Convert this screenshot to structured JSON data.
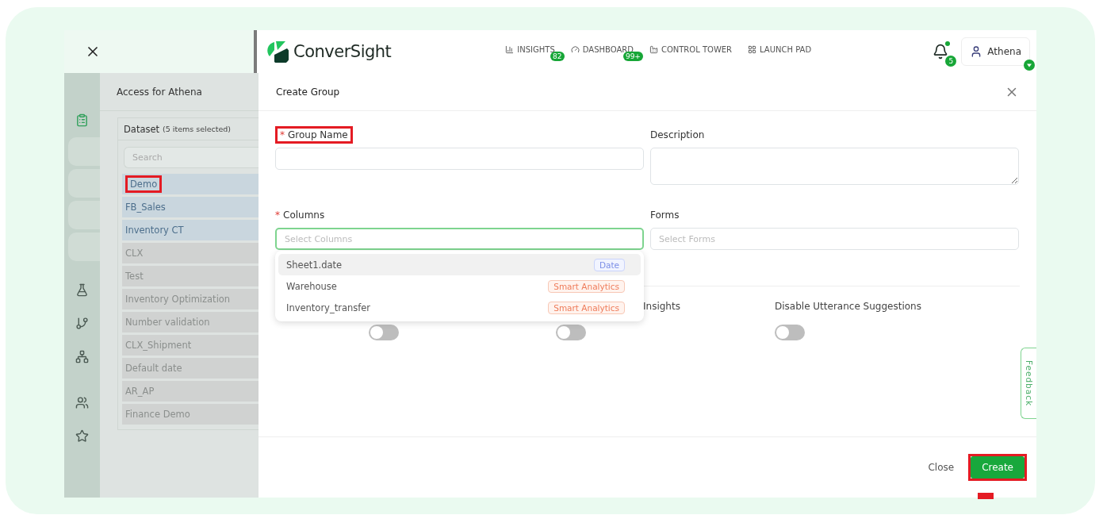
{
  "topbar": {
    "brand": "ConverSight",
    "nav": [
      {
        "kind": "insights",
        "label": "INSIGHTS",
        "badge": "82"
      },
      {
        "kind": "dashboard",
        "label": "DASHBOARD",
        "badge": "99+"
      },
      {
        "kind": "tower",
        "label": "CONTROL TOWER"
      },
      {
        "kind": "launch",
        "label": "LAUNCH PAD"
      }
    ],
    "notifications": "5",
    "user": "Athena"
  },
  "rail": [
    {
      "kind": "doc",
      "selected": true
    },
    {
      "kind": "blank",
      "selected": false
    },
    {
      "kind": "blank",
      "selected": false
    },
    {
      "kind": "blank",
      "selected": false
    },
    {
      "kind": "blank",
      "selected": false
    },
    {
      "kind": "flask",
      "selected": false
    },
    {
      "kind": "branch",
      "selected": false
    },
    {
      "kind": "tree",
      "selected": false
    },
    {
      "kind": "people",
      "selected": false
    },
    {
      "kind": "star",
      "selected": false
    }
  ],
  "access": {
    "title": "Access for Athena",
    "dataset_label": "Dataset",
    "dataset_count": "(5 items selected)",
    "search": {
      "placeholder": "Search"
    },
    "items": [
      {
        "label": "Demo",
        "selected": true,
        "highlighted": true
      },
      {
        "label": "FB_Sales",
        "selected": true,
        "highlighted": false
      },
      {
        "label": "Inventory CT",
        "selected": true,
        "highlighted": false
      },
      {
        "label": "CLX",
        "selected": false,
        "highlighted": false
      },
      {
        "label": "Test",
        "selected": false,
        "highlighted": false
      },
      {
        "label": "Inventory Optimization",
        "selected": false,
        "highlighted": false
      },
      {
        "label": "Number validation",
        "selected": false,
        "highlighted": false
      },
      {
        "label": "CLX_Shipment",
        "selected": false,
        "highlighted": false
      },
      {
        "label": "Default date",
        "selected": false,
        "highlighted": false
      },
      {
        "label": "AR_AP",
        "selected": false,
        "highlighted": false
      },
      {
        "label": "Finance Demo",
        "selected": false,
        "highlighted": false
      }
    ]
  },
  "modal": {
    "title": "Create Group",
    "fields": [
      {
        "kind": "input",
        "label": "Group Name",
        "required_mark": "*",
        "highlighted": true,
        "focused": false
      },
      {
        "kind": "textarea",
        "label": "Description",
        "highlighted": false,
        "focused": false
      },
      {
        "kind": "select",
        "label": "Columns",
        "required_mark": "*",
        "highlighted": false,
        "focused": true,
        "placeholder": "Select Columns"
      },
      {
        "kind": "select",
        "label": "Forms",
        "highlighted": false,
        "focused": false,
        "placeholder": "Select Forms"
      }
    ],
    "column_options": [
      {
        "label": "Sheet1.date",
        "tag": "Date",
        "kind": "date",
        "selected": true
      },
      {
        "label": "Warehouse",
        "tag": "Smart Analytics",
        "kind": "smart",
        "selected": false
      },
      {
        "label": "Inventory_transfer",
        "tag": "Smart Analytics",
        "kind": "smart",
        "selected": false
      }
    ],
    "toggles": [
      {
        "on": false
      },
      {
        "label": "Insights",
        "on": false
      },
      {
        "label": "Disable Utterance Suggestions",
        "on": false
      }
    ],
    "buttons": [
      {
        "kind": "plain",
        "label": "Close",
        "highlighted": false
      },
      {
        "kind": "primary",
        "label": "Create",
        "highlighted": true
      }
    ]
  },
  "feedback": "Feedback"
}
